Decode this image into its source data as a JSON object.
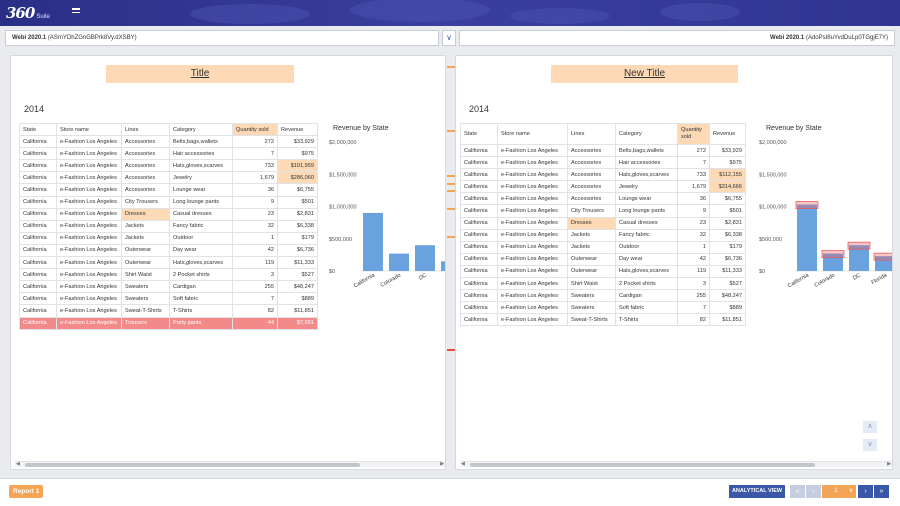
{
  "app": {
    "brand": "360",
    "suite": "Suite"
  },
  "docs": {
    "left": {
      "name": "Webi 2020.1",
      "id": "(ASmYDhZGnGBPrk8Vy.dXSBY)"
    },
    "right": {
      "name": "Webi 2020.1",
      "id": "(AdoPsI8uYvdDuLp0TGgjE7Y)"
    }
  },
  "left_report": {
    "title": "Title",
    "year": "2014",
    "columns": [
      "State",
      "Store name",
      "Lines",
      "Category",
      "Quantity sold",
      "Revenue"
    ],
    "rows": [
      [
        "California",
        "e-Fashion Los Angeles",
        "Accessories",
        "Belts,bags,wallets",
        "272",
        "$33,929"
      ],
      [
        "California",
        "e-Fashion Los Angeles",
        "Accessories",
        "Hair accessories",
        "7",
        "$975"
      ],
      [
        "California",
        "e-Fashion Los Angeles",
        "Accessories",
        "Hats,gloves,scarves",
        "733",
        "$101,959"
      ],
      [
        "California",
        "e-Fashion Los Angeles",
        "Accessories",
        "Jewelry",
        "1,679",
        "$286,060"
      ],
      [
        "California",
        "e-Fashion Los Angeles",
        "Accessories",
        "Lounge wear",
        "36",
        "$6,755"
      ],
      [
        "California",
        "e-Fashion Los Angeles",
        "City Trousers",
        "Long lounge pants",
        "9",
        "$501"
      ],
      [
        "California",
        "e-Fashion Los Angeles",
        "Dresses",
        "Casual dresses",
        "23",
        "$2,831"
      ],
      [
        "California",
        "e-Fashion Los Angeles",
        "Jackets",
        "Fancy fabric",
        "32",
        "$6,338"
      ],
      [
        "California",
        "e-Fashion Los Angeles",
        "Jackets",
        "Outdoor",
        "1",
        "$179"
      ],
      [
        "California",
        "e-Fashion Los Angeles",
        "Outerwear",
        "Day wear",
        "42",
        "$6,736"
      ],
      [
        "California",
        "e-Fashion Los Angeles",
        "Outerwear",
        "Hats,gloves,scarves",
        "119",
        "$11,333"
      ],
      [
        "California",
        "e-Fashion Los Angeles",
        "Shirt Waist",
        "2 Pocket shirts",
        "3",
        "$527"
      ],
      [
        "California",
        "e-Fashion Los Angeles",
        "Sweaters",
        "Cardigan",
        "255",
        "$48,247"
      ],
      [
        "California",
        "e-Fashion Los Angeles",
        "Sweaters",
        "Soft fabric",
        "7",
        "$889"
      ],
      [
        "California",
        "e-Fashion Los Angeles",
        "Sweat-T-Shirts",
        "T-Shirts",
        "82",
        "$11,851"
      ],
      [
        "California",
        "e-Fashion Los Angeles",
        "Trousers",
        "Party pants",
        "44",
        "$7,691"
      ]
    ],
    "chart_title": "Revenue by State"
  },
  "right_report": {
    "title": "New Title",
    "year": "2014",
    "columns": [
      "State",
      "Store name",
      "Lines",
      "Category",
      "Quantity sold",
      "Revenue"
    ],
    "rows": [
      [
        "California",
        "e-Fashion Los Angeles",
        "Accessories",
        "Belts,bags,wallets",
        "272",
        "$33,929"
      ],
      [
        "California",
        "e-Fashion Los Angeles",
        "Accessories",
        "Hair accessories",
        "7",
        "$975"
      ],
      [
        "California",
        "e-Fashion Los Angeles",
        "Accessories",
        "Hats,gloves,scarves",
        "733",
        "$112,155"
      ],
      [
        "California",
        "e-Fashion Los Angeles",
        "Accessories",
        "Jewelry",
        "1,679",
        "$314,666"
      ],
      [
        "California",
        "e-Fashion Los Angeles",
        "Accessories",
        "Lounge wear",
        "36",
        "$6,755"
      ],
      [
        "California",
        "e-Fashion Los Angeles",
        "City Trousers",
        "Long lounge pants",
        "9",
        "$501"
      ],
      [
        "California",
        "e-Fashion Los Angeles",
        "Dresses",
        "Casual dresses",
        "23",
        "$2,831"
      ],
      [
        "California",
        "e-Fashion Los Angeles",
        "Jackets",
        "Fancy fabric",
        "32",
        "$6,338"
      ],
      [
        "California",
        "e-Fashion Los Angeles",
        "Jackets",
        "Outdoor",
        "1",
        "$179"
      ],
      [
        "California",
        "e-Fashion Los Angeles",
        "Outerwear",
        "Day wear",
        "42",
        "$6,736"
      ],
      [
        "California",
        "e-Fashion Los Angeles",
        "Outerwear",
        "Hats,gloves,scarves",
        "119",
        "$11,333"
      ],
      [
        "California",
        "e-Fashion Los Angeles",
        "Shirt Waist",
        "2 Pocket shirts",
        "3",
        "$527"
      ],
      [
        "California",
        "e-Fashion Los Angeles",
        "Sweaters",
        "Cardigan",
        "255",
        "$48,247"
      ],
      [
        "California",
        "e-Fashion Los Angeles",
        "Sweaters",
        "Soft fabric",
        "7",
        "$889"
      ],
      [
        "California",
        "e-Fashion Los Angeles",
        "Sweat-T-Shirts",
        "T-Shirts",
        "82",
        "$11,851"
      ]
    ],
    "chart_title": "Revenue by State"
  },
  "chart_data": [
    {
      "type": "bar",
      "title": "Revenue by State",
      "categories": [
        "California",
        "Colorado",
        "DC",
        "F"
      ],
      "values": [
        900000,
        270000,
        400000,
        150000
      ],
      "yticks": [
        "$0",
        "$500,000",
        "$1,000,000",
        "$1,500,000",
        "$2,000,000"
      ],
      "ylim": [
        0,
        2000000
      ],
      "color": "#6aa2e0"
    },
    {
      "type": "bar",
      "title": "Revenue by State",
      "categories": [
        "California",
        "Colorado",
        "DC",
        "Florida"
      ],
      "values": [
        1030000,
        270000,
        400000,
        230000
      ],
      "yticks": [
        "$0",
        "$500,000",
        "$1,000,000",
        "$1,500,000",
        "$2,000,000"
      ],
      "ylim": [
        0,
        2000000
      ],
      "color": "#6aa2e0",
      "changed_color": "#e85c5c"
    }
  ],
  "footer": {
    "report_tab": "Report 1",
    "analytical_view": "ANALYTICAL VIEW",
    "page": "1"
  },
  "icons": {
    "compare": "double-chevron-down-icon",
    "first": "first-page-icon",
    "prev": "prev-page-icon",
    "next": "next-page-icon",
    "last": "last-page-icon"
  },
  "colors": {
    "header": "#2f3591",
    "highlight_orange": "#fdd9b5",
    "row_red": "#f28a8a",
    "accent_orange": "#f3a455",
    "button_blue": "#3b57a8"
  }
}
